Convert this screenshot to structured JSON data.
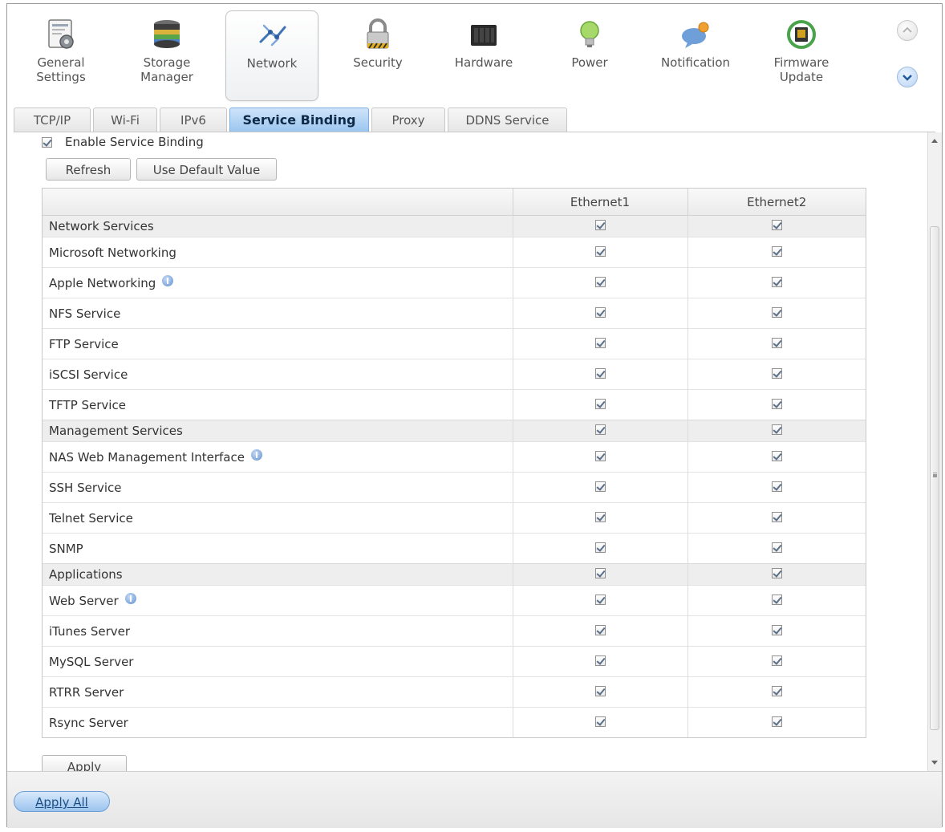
{
  "toolbar": {
    "items": [
      {
        "label": "General\nSettings",
        "icon": "general-settings-icon"
      },
      {
        "label": "Storage\nManager",
        "icon": "storage-manager-icon"
      },
      {
        "label": "Network",
        "icon": "network-icon"
      },
      {
        "label": "Security",
        "icon": "security-lock-icon"
      },
      {
        "label": "Hardware",
        "icon": "hardware-icon"
      },
      {
        "label": "Power",
        "icon": "power-bulb-icon"
      },
      {
        "label": "Notification",
        "icon": "notification-icon"
      },
      {
        "label": "Firmware\nUpdate",
        "icon": "firmware-update-icon"
      }
    ],
    "active_index": 2
  },
  "tabs": [
    {
      "label": "TCP/IP"
    },
    {
      "label": "Wi-Fi"
    },
    {
      "label": "IPv6"
    },
    {
      "label": "Service Binding"
    },
    {
      "label": "Proxy"
    },
    {
      "label": "DDNS Service"
    }
  ],
  "active_tab_index": 3,
  "service_binding": {
    "enable_label": "Enable Service Binding",
    "enable_checked": true,
    "refresh_label": "Refresh",
    "default_label": "Use Default Value",
    "columns": [
      "",
      "Ethernet1",
      "Ethernet2"
    ],
    "rows": [
      {
        "type": "group",
        "name": "Network Services",
        "eth1": true,
        "eth2": true
      },
      {
        "type": "row",
        "name": "Microsoft Networking",
        "eth1": true,
        "eth2": true
      },
      {
        "type": "row",
        "name": "Apple Networking",
        "info": true,
        "eth1": true,
        "eth2": true
      },
      {
        "type": "row",
        "name": "NFS Service",
        "eth1": true,
        "eth2": true
      },
      {
        "type": "row",
        "name": "FTP Service",
        "eth1": true,
        "eth2": true
      },
      {
        "type": "row",
        "name": "iSCSI Service",
        "eth1": true,
        "eth2": true
      },
      {
        "type": "row",
        "name": "TFTP Service",
        "eth1": true,
        "eth2": true
      },
      {
        "type": "group",
        "name": "Management Services",
        "eth1": true,
        "eth2": true
      },
      {
        "type": "row",
        "name": "NAS Web Management Interface",
        "info": true,
        "eth1": true,
        "eth2": true
      },
      {
        "type": "row",
        "name": "SSH Service",
        "eth1": true,
        "eth2": true
      },
      {
        "type": "row",
        "name": "Telnet Service",
        "eth1": true,
        "eth2": true
      },
      {
        "type": "row",
        "name": "SNMP",
        "eth1": true,
        "eth2": true
      },
      {
        "type": "group",
        "name": "Applications",
        "eth1": true,
        "eth2": true
      },
      {
        "type": "row",
        "name": "Web Server",
        "info": true,
        "eth1": true,
        "eth2": true
      },
      {
        "type": "row",
        "name": "iTunes Server",
        "eth1": true,
        "eth2": true
      },
      {
        "type": "row",
        "name": "MySQL Server",
        "eth1": true,
        "eth2": true
      },
      {
        "type": "row",
        "name": "RTRR Server",
        "eth1": true,
        "eth2": true
      },
      {
        "type": "row",
        "name": "Rsync Server",
        "eth1": true,
        "eth2": true
      }
    ],
    "apply_label": "Apply"
  },
  "footer": {
    "apply_all_label": "Apply All"
  }
}
